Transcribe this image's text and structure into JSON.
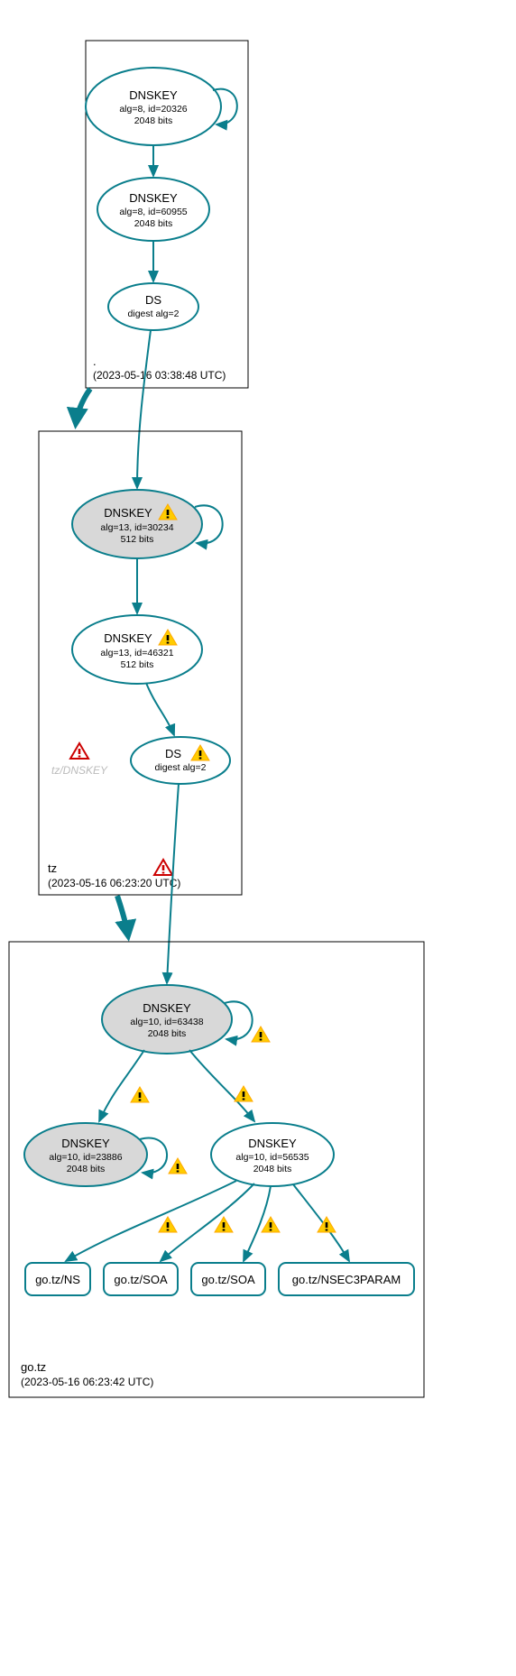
{
  "zones": {
    "root": {
      "label": ".",
      "time": "(2023-05-16 03:38:48 UTC)",
      "dnskey1": {
        "title": "DNSKEY",
        "line1": "alg=8, id=20326",
        "line2": "2048 bits"
      },
      "dnskey2": {
        "title": "DNSKEY",
        "line1": "alg=8, id=60955",
        "line2": "2048 bits"
      },
      "ds": {
        "title": "DS",
        "line1": "digest alg=2"
      }
    },
    "tz": {
      "label": "tz",
      "time": "(2023-05-16 06:23:20 UTC)",
      "dnskey1": {
        "title": "DNSKEY",
        "line1": "alg=13, id=30234",
        "line2": "512 bits"
      },
      "dnskey2": {
        "title": "DNSKEY",
        "line1": "alg=13, id=46321",
        "line2": "512 bits"
      },
      "ds": {
        "title": "DS",
        "line1": "digest alg=2"
      },
      "missing": "tz/DNSKEY"
    },
    "gotz": {
      "label": "go.tz",
      "time": "(2023-05-16 06:23:42 UTC)",
      "dnskey1": {
        "title": "DNSKEY",
        "line1": "alg=10, id=63438",
        "line2": "2048 bits"
      },
      "dnskey2": {
        "title": "DNSKEY",
        "line1": "alg=10, id=23886",
        "line2": "2048 bits"
      },
      "dnskey3": {
        "title": "DNSKEY",
        "line1": "alg=10, id=56535",
        "line2": "2048 bits"
      },
      "rr1": "go.tz/NS",
      "rr2": "go.tz/SOA",
      "rr3": "go.tz/SOA",
      "rr4": "go.tz/NSEC3PARAM"
    }
  }
}
